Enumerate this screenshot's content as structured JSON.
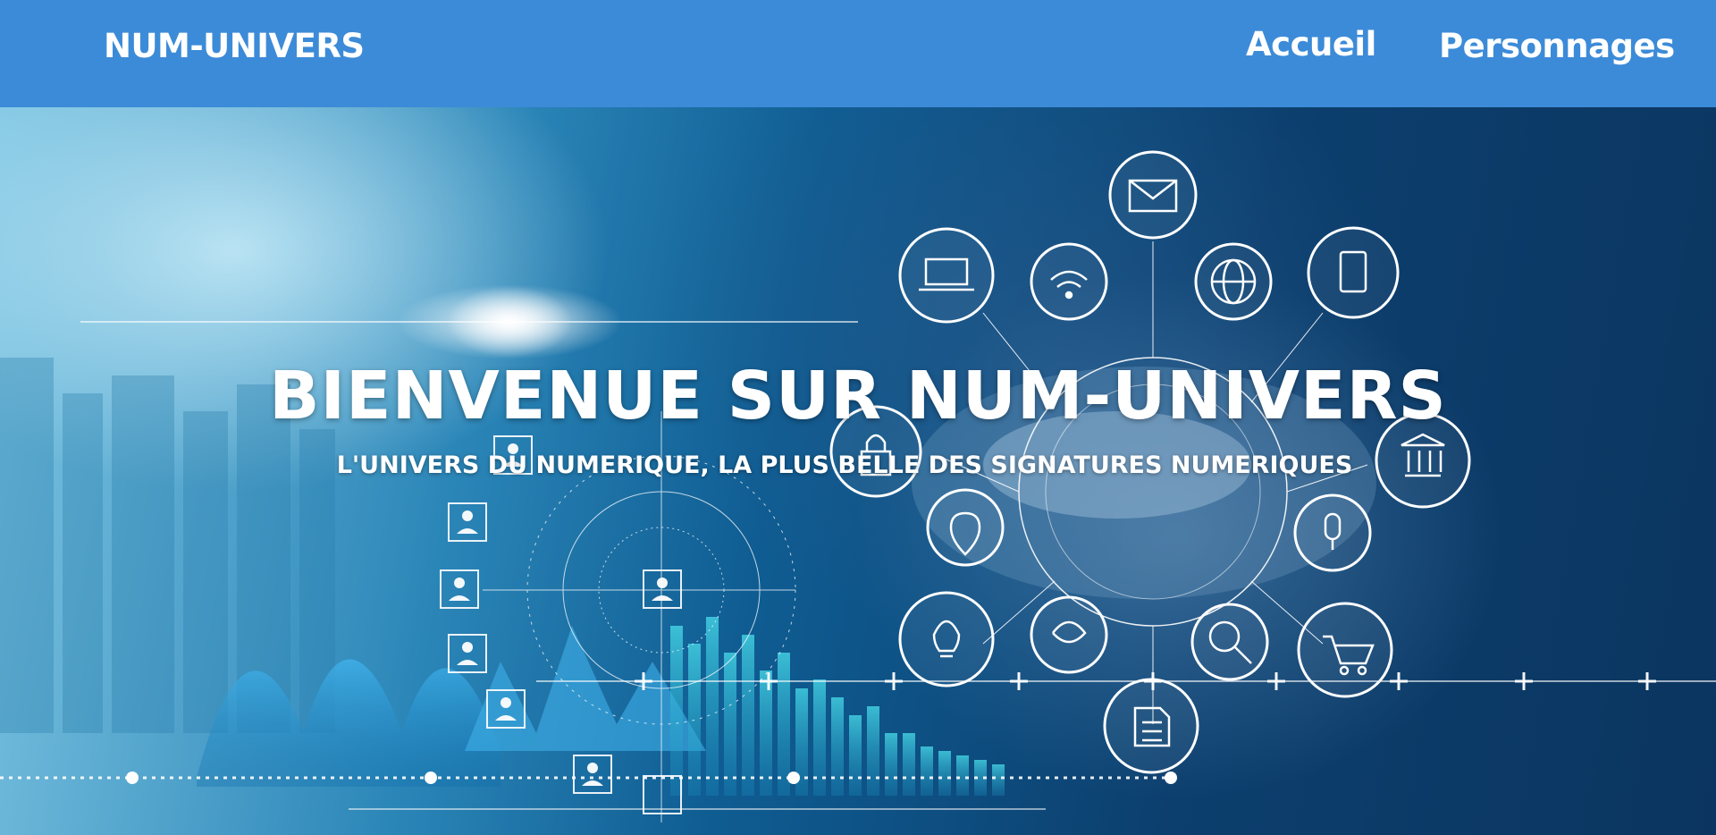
{
  "navbar": {
    "brand": "NUM-UNIVERS",
    "links": [
      {
        "label": "Accueil"
      },
      {
        "label": "Personnages"
      }
    ],
    "background": "#3c8bd8"
  },
  "hero": {
    "title": "BIENVENUE SUR NUM-UNIVERS",
    "subtitle": "L'UNIVERS DU NUMERIQUE, LA PLUS BELLE DES SIGNATURES NUMERIQUES",
    "icons": [
      "mail-icon",
      "laptop-icon",
      "wifi-icon",
      "globe-icon",
      "tablet-icon",
      "bank-icon",
      "microphone-icon",
      "cart-icon",
      "document-icon",
      "search-chart-icon",
      "brain-icon",
      "lightbulb-icon",
      "location-pin-icon",
      "lock-icon",
      "user-icon"
    ]
  }
}
